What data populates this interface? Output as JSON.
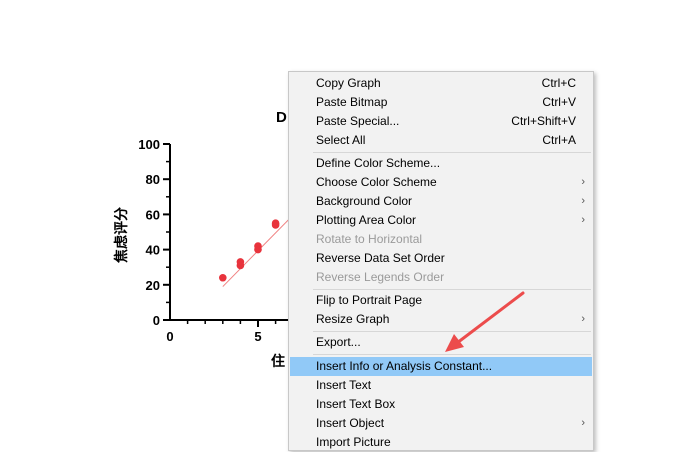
{
  "chart_data": {
    "type": "scatter",
    "title_visible": "D",
    "xlabel_visible": "住",
    "ylabel": "焦虑评分",
    "x_ticks": [
      "0",
      "5"
    ],
    "y_ticks": [
      "0",
      "20",
      "40",
      "60",
      "80",
      "100"
    ],
    "ylim": [
      0,
      100
    ],
    "xlim": [
      0,
      13
    ],
    "grid": false,
    "points": [
      {
        "x": 3,
        "y": 24
      },
      {
        "x": 4,
        "y": 31
      },
      {
        "x": 4,
        "y": 33
      },
      {
        "x": 5,
        "y": 40
      },
      {
        "x": 5,
        "y": 42
      },
      {
        "x": 6,
        "y": 54
      },
      {
        "x": 6,
        "y": 55
      }
    ],
    "fit_line": {
      "x": [
        3,
        9
      ],
      "y": [
        19,
        80
      ]
    },
    "point_color": "#e8333c",
    "line_color": "#f08080"
  },
  "context_menu": {
    "items": [
      {
        "label": "Copy Graph",
        "shortcut": "Ctrl+C"
      },
      {
        "label": "Paste Bitmap",
        "shortcut": "Ctrl+V"
      },
      {
        "label": "Paste Special...",
        "shortcut": "Ctrl+Shift+V"
      },
      {
        "label": "Select All",
        "shortcut": "Ctrl+A"
      },
      {
        "label": "Define Color Scheme..."
      },
      {
        "label": "Choose Color Scheme",
        "submenu": true
      },
      {
        "label": "Background Color",
        "submenu": true
      },
      {
        "label": "Plotting Area Color",
        "submenu": true
      },
      {
        "label": "Rotate to Horizontal",
        "disabled": true
      },
      {
        "label": "Reverse Data Set Order"
      },
      {
        "label": "Reverse Legends Order",
        "disabled": true
      },
      {
        "label": "Flip to Portrait Page"
      },
      {
        "label": "Resize Graph",
        "submenu": true
      },
      {
        "label": "Export..."
      },
      {
        "label": "Insert Info or Analysis Constant...",
        "highlighted": true
      },
      {
        "label": "Insert Text"
      },
      {
        "label": "Insert Text Box"
      },
      {
        "label": "Insert Object",
        "submenu": true
      },
      {
        "label": "Import Picture"
      }
    ],
    "submenu_glyph": "›"
  },
  "colors": {
    "highlight": "#91c9f7",
    "annotation_arrow": "#ec4c4c"
  }
}
